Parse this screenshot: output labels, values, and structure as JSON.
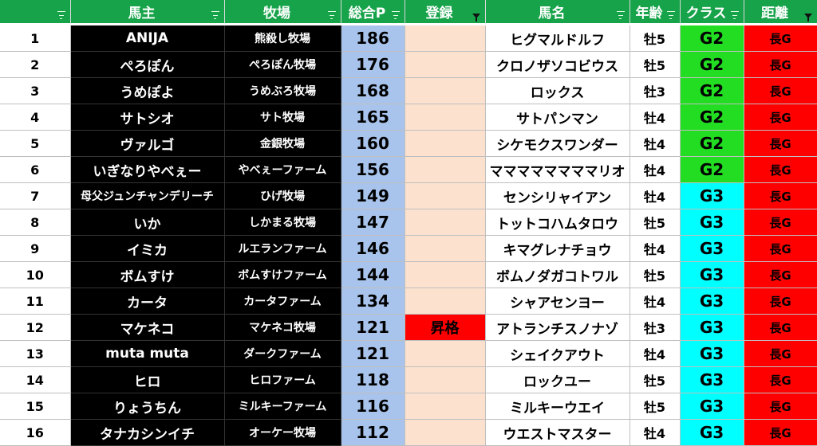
{
  "headers": [
    "",
    "馬主",
    "牧場",
    "総合P",
    "登録",
    "馬名",
    "年齢",
    "クラス",
    "距離"
  ],
  "colors": {
    "header_bg": "#17a34a",
    "owner_bg": "#000000",
    "points_bg": "#a9c4ec",
    "reg_bg": "#fde1cf",
    "promo_bg": "#ff0000",
    "g2_bg": "#22dd22",
    "g3_bg": "#00ffff",
    "dist_bg": "#ff0000"
  },
  "rows": [
    {
      "num": "1",
      "owner": "ANIJA",
      "farm": "熊殺し牧場",
      "points": "186",
      "reg": "",
      "horse": "ヒグマルドルフ",
      "age": "牡5",
      "class": "G2",
      "dist": "長G"
    },
    {
      "num": "2",
      "owner": "ぺろぽん",
      "farm": "ぺろぽん牧場",
      "points": "176",
      "reg": "",
      "horse": "クロノザソコビウス",
      "age": "牡5",
      "class": "G2",
      "dist": "長G"
    },
    {
      "num": "3",
      "owner": "うめぽよ",
      "farm": "うめぶろ牧場",
      "points": "168",
      "reg": "",
      "horse": "ロックス",
      "age": "牡3",
      "class": "G2",
      "dist": "長G"
    },
    {
      "num": "4",
      "owner": "サトシオ",
      "farm": "サト牧場",
      "points": "165",
      "reg": "",
      "horse": "サトパンマン",
      "age": "牡4",
      "class": "G2",
      "dist": "長G"
    },
    {
      "num": "5",
      "owner": "ヴァルゴ",
      "farm": "金銀牧場",
      "points": "160",
      "reg": "",
      "horse": "シケモクスワンダー",
      "age": "牡4",
      "class": "G2",
      "dist": "長G"
    },
    {
      "num": "6",
      "owner": "いぎなりやべぇー",
      "farm": "やべぇーファーム",
      "points": "156",
      "reg": "",
      "horse": "ママママママママリオ",
      "age": "牡4",
      "class": "G2",
      "dist": "長G"
    },
    {
      "num": "7",
      "owner": "母父ジュンチャンデリーチ",
      "farm": "ひげ牧場",
      "points": "149",
      "reg": "",
      "horse": "センシリャイアン",
      "age": "牡4",
      "class": "G3",
      "dist": "長G"
    },
    {
      "num": "8",
      "owner": "いか",
      "farm": "しかまる牧場",
      "points": "147",
      "reg": "",
      "horse": "トットコハムタロウ",
      "age": "牡5",
      "class": "G3",
      "dist": "長G"
    },
    {
      "num": "9",
      "owner": "イミカ",
      "farm": "ルエランファーム",
      "points": "146",
      "reg": "",
      "horse": "キマグレナチョウ",
      "age": "牡4",
      "class": "G3",
      "dist": "長G"
    },
    {
      "num": "10",
      "owner": "ボムすけ",
      "farm": "ボムすけファーム",
      "points": "144",
      "reg": "",
      "horse": "ボムノダガコトワル",
      "age": "牡5",
      "class": "G3",
      "dist": "長G"
    },
    {
      "num": "11",
      "owner": "カータ",
      "farm": "カータファーム",
      "points": "134",
      "reg": "",
      "horse": "シャアセンヨー",
      "age": "牡4",
      "class": "G3",
      "dist": "長G"
    },
    {
      "num": "12",
      "owner": "マケネコ",
      "farm": "マケネコ牧場",
      "points": "121",
      "reg": "昇格",
      "horse": "アトランチスノナゾ",
      "age": "牡3",
      "class": "G3",
      "dist": "長G"
    },
    {
      "num": "13",
      "owner": "muta muta",
      "farm": "ダークファーム",
      "points": "121",
      "reg": "",
      "horse": "シェイクアウト",
      "age": "牡4",
      "class": "G3",
      "dist": "長G"
    },
    {
      "num": "14",
      "owner": "ヒロ",
      "farm": "ヒロファーム",
      "points": "118",
      "reg": "",
      "horse": "ロックユー",
      "age": "牡5",
      "class": "G3",
      "dist": "長G"
    },
    {
      "num": "15",
      "owner": "りょうちん",
      "farm": "ミルキーファーム",
      "points": "116",
      "reg": "",
      "horse": "ミルキーウエイ",
      "age": "牡5",
      "class": "G3",
      "dist": "長G"
    },
    {
      "num": "16",
      "owner": "タナカシンイチ",
      "farm": "オーケー牧場",
      "points": "112",
      "reg": "",
      "horse": "ウエストマスター",
      "age": "牡4",
      "class": "G3",
      "dist": "長G"
    }
  ]
}
